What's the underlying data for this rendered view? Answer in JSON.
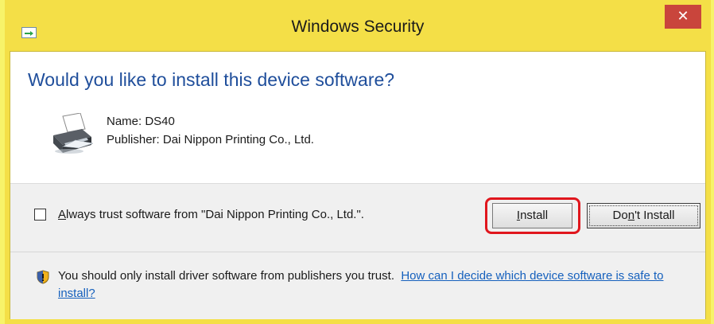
{
  "window": {
    "title": "Windows Security",
    "close_glyph": "✕",
    "title_icon": "device-install-icon"
  },
  "content": {
    "heading": "Would you like to install this device software?",
    "device_icon": "printer-icon",
    "name_line": "Name: DS40",
    "publisher_line": "Publisher: Dai Nippon Printing Co., Ltd."
  },
  "options": {
    "trust_checked": false,
    "trust_label_access_key": "A",
    "trust_label_rest": "lways trust software from \"Dai Nippon Printing Co., Ltd.\".",
    "install_access_key": "I",
    "install_rest": "nstall",
    "dont_install_pre": "Do",
    "dont_install_key": "n",
    "dont_install_post": "'t Install"
  },
  "warning": {
    "icon": "shield-warning-icon",
    "text": "You should only install driver software from publishers you trust.",
    "link_text": "How can I decide which device software is safe to install?"
  },
  "colors": {
    "background": "#f7f36a",
    "frame": "#f4df47",
    "close": "#c9453c",
    "heading": "#1f4e9b",
    "link": "#1560bd",
    "highlight": "#e0161d"
  }
}
